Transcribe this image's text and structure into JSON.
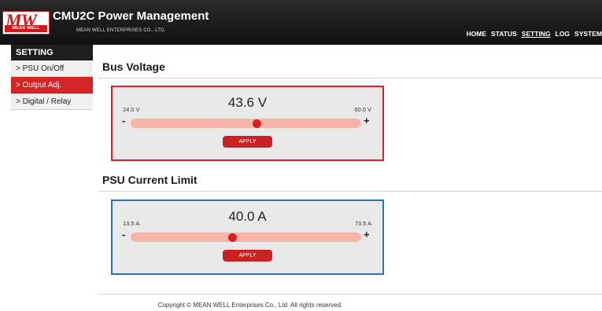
{
  "header": {
    "logo_text": "MW",
    "logo_subtext": "MEAN WELL",
    "title": "CMU2C Power Management",
    "company": "MEAN WELL ENTERPRISES CO., LTD.",
    "nav": [
      "HOME",
      "STATUS",
      "SETTING",
      "LOG",
      "SYSTEM"
    ],
    "active_nav": "SETTING"
  },
  "sidebar": {
    "heading": "SETTING",
    "items": [
      {
        "label": "> PSU On/Off"
      },
      {
        "label": "> Output Adj."
      },
      {
        "label": "> Digital / Relay"
      }
    ],
    "active_index": 1
  },
  "bus_voltage": {
    "title": "Bus Voltage",
    "min_label": "24.0 V",
    "max_label": "60.0 V",
    "value_label": "43.6 V",
    "min": 24.0,
    "max": 60.0,
    "value": 43.6,
    "minus": "-",
    "plus": "+",
    "apply_label": "APPLY"
  },
  "current_limit": {
    "title": "PSU Current Limit",
    "min_label": "13.5 A",
    "max_label": "73.5 A",
    "value_label": "40.0 A",
    "min": 13.5,
    "max": 73.5,
    "value": 40.0,
    "minus": "-",
    "plus": "+",
    "apply_label": "APPLY"
  },
  "footer": {
    "copyright": "Copyright © MEAN WELL Enterprises Co., Ltd. All rights reserved."
  },
  "colors": {
    "accent_red": "#d42626",
    "voltage_border": "#e01d2a",
    "current_border": "#2c72b8",
    "slider_track": "#f6b5a8"
  }
}
